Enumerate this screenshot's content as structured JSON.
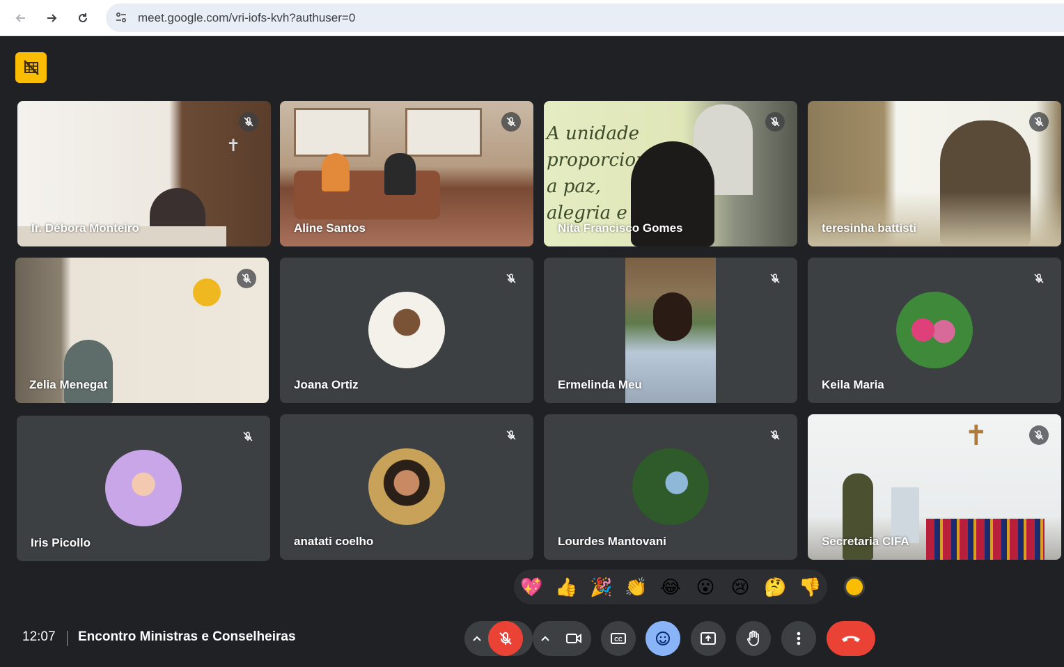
{
  "browser": {
    "url": "meet.google.com/vri-iofs-kvh?authuser=0"
  },
  "participants": [
    {
      "name": "Ir. Débora Monteiro"
    },
    {
      "name": "Aline Santos"
    },
    {
      "name": "Nita Francisco Gomes"
    },
    {
      "name": "teresinha battisti"
    },
    {
      "name": "Zelia Menegat"
    },
    {
      "name": "Joana Ortiz"
    },
    {
      "name": "Ermelinda Meu"
    },
    {
      "name": "Keila Maria"
    },
    {
      "name": "Iris Picollo"
    },
    {
      "name": "anatati coelho"
    },
    {
      "name": "Lourdes Mantovani"
    },
    {
      "name": "Secretaria CIFA"
    }
  ],
  "video_text": {
    "poster": [
      "A unidade",
      "proporciona",
      "a paz,",
      "alegria e"
    ]
  },
  "reactions": [
    "💖",
    "👍",
    "🎉",
    "👏",
    "😂",
    "😮",
    "😢",
    "🤔",
    "👎"
  ],
  "footer": {
    "time": "12:07",
    "meeting_title": "Encontro Ministras e Conselheiras"
  },
  "colors": {
    "background": "#202124",
    "tile": "#3c4043",
    "recording_badge": "#fbbc04",
    "mic_off_red": "#ea4335",
    "active_blue": "#8ab4f8"
  }
}
